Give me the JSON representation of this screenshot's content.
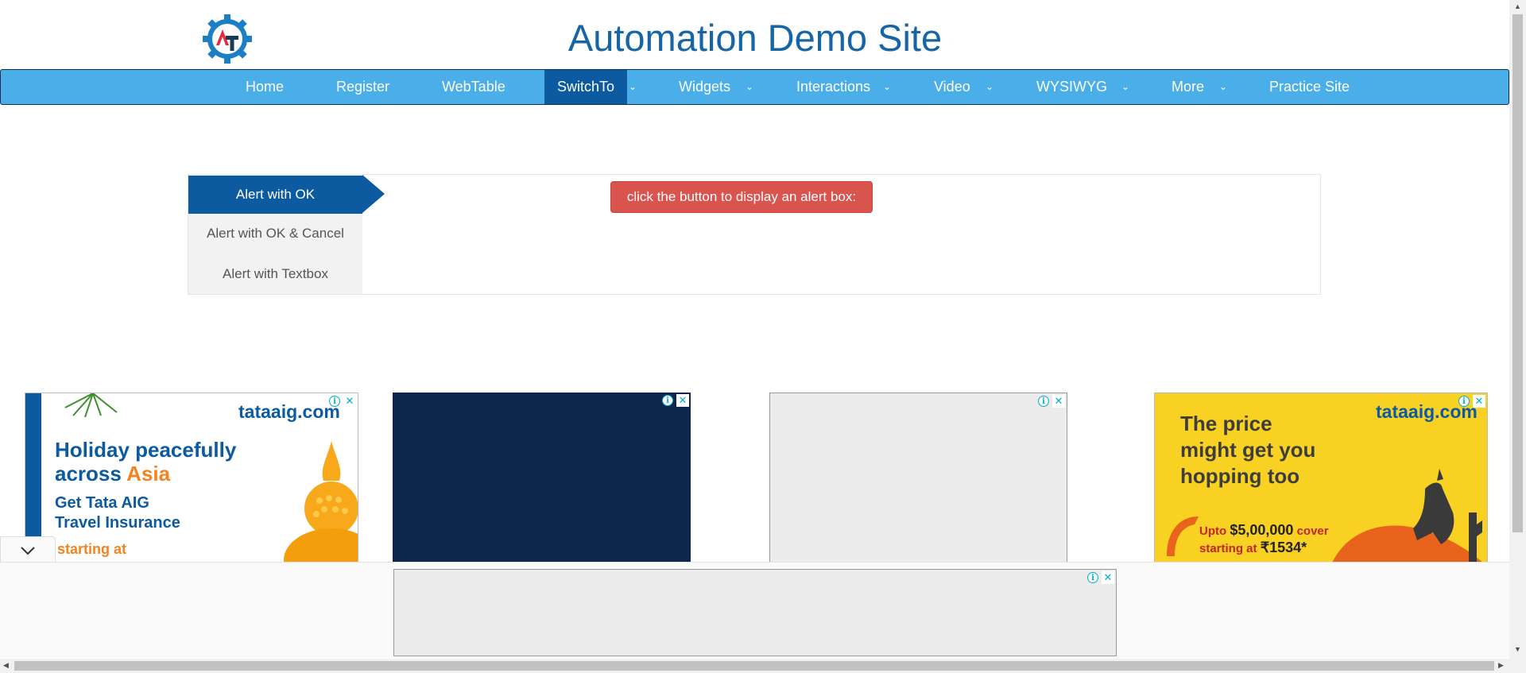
{
  "site": {
    "title": "Automation Demo Site",
    "logo_text": "AT"
  },
  "nav": {
    "items": [
      {
        "label": "Home"
      },
      {
        "label": "Register"
      },
      {
        "label": "WebTable"
      },
      {
        "label": "SwitchTo",
        "active": true
      },
      {
        "label": "Widgets"
      },
      {
        "label": "Interactions"
      },
      {
        "label": "Video"
      },
      {
        "label": "WYSIWYG"
      },
      {
        "label": "More"
      },
      {
        "label": "Practice Site"
      }
    ]
  },
  "alerts": {
    "tabs": [
      {
        "label": "Alert with OK",
        "active": true
      },
      {
        "label": "Alert with OK & Cancel"
      },
      {
        "label": "Alert with Textbox"
      }
    ],
    "button_label": "click the button to display an alert box:"
  },
  "ads": {
    "info_icon": "i",
    "close_icon": "✕",
    "ad1": {
      "brand": "tataaig.com",
      "headline_1": "Holiday peacefully",
      "headline_2a": "across ",
      "headline_2b": "Asia",
      "sub_1": "Get Tata AIG",
      "sub_2": "Travel Insurance",
      "starting": "starting at"
    },
    "ad4": {
      "brand": "tataaig.com",
      "headline_1": "The price",
      "headline_2": "might get you",
      "headline_3": "hopping too",
      "cover_pre": "Upto ",
      "cover_amount": "$5,00,000",
      "cover_post": " cover",
      "start_pre": "starting at ",
      "start_amount": "₹1534*"
    }
  },
  "colors": {
    "nav_bg": "#4aaee8",
    "nav_active": "#0c5aa0",
    "title": "#1565a7",
    "alert_button": "#d9534f"
  }
}
